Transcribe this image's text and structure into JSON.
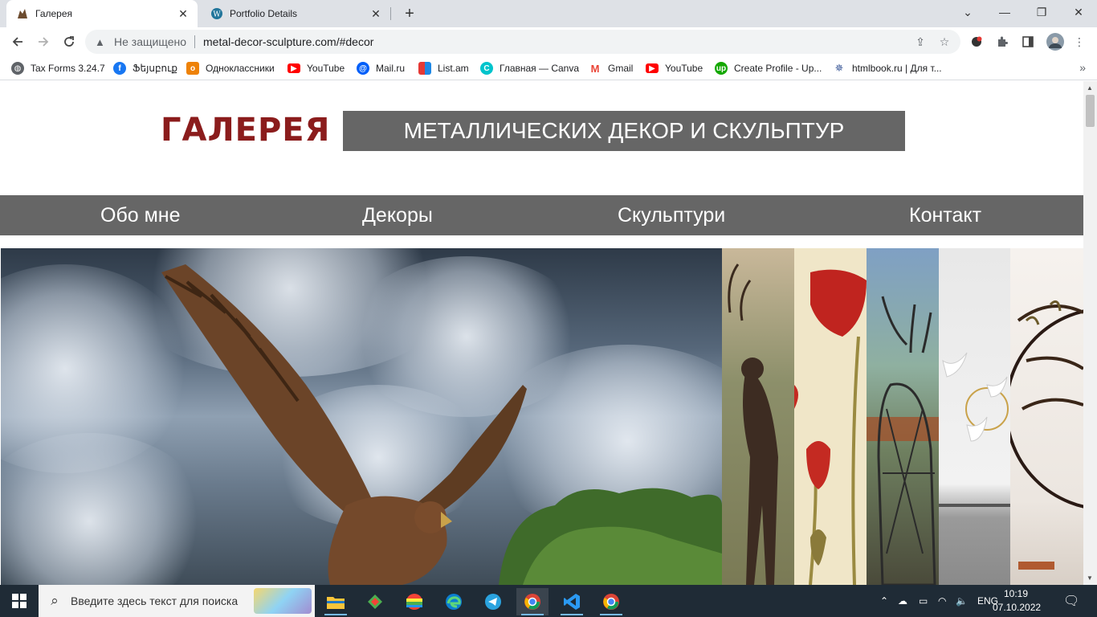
{
  "browser": {
    "tabs": [
      {
        "title": "Галерея",
        "icon": "sculpture-favicon",
        "active": true
      },
      {
        "title": "Portfolio Details",
        "icon": "wordpress-favicon",
        "active": false
      }
    ],
    "new_tab": "+",
    "window_controls": {
      "dropdown": "⌄",
      "minimize": "—",
      "restore": "❐",
      "close": "✕"
    },
    "omnibox": {
      "security_label": "Не защищено",
      "url": "metal-decor-sculpture.com/#decor"
    },
    "bookmarks": [
      {
        "label": "Tax Forms 3.24.7",
        "color": "#5f6368",
        "icon": "globe-icon"
      },
      {
        "label": "Ֆեյսբուք",
        "color": "#1877f2",
        "icon": "facebook-icon"
      },
      {
        "label": "Одноклассники",
        "color": "#ee8208",
        "icon": "ok-icon"
      },
      {
        "label": "YouTube",
        "color": "#ff0000",
        "icon": "youtube-icon"
      },
      {
        "label": "Mail.ru",
        "color": "#005ff9",
        "icon": "mailru-icon"
      },
      {
        "label": "List.am",
        "color": "#f4b400",
        "icon": "listam-icon"
      },
      {
        "label": "Главная — Canva",
        "color": "#00c4cc",
        "icon": "canva-icon"
      },
      {
        "label": "Gmail",
        "color": "#ea4335",
        "icon": "gmail-icon"
      },
      {
        "label": "YouTube",
        "color": "#ff0000",
        "icon": "youtube-icon"
      },
      {
        "label": "Create Profile - Up...",
        "color": "#14a800",
        "icon": "upwork-icon"
      },
      {
        "label": "htmlbook.ru | Для т...",
        "color": "#3b5998",
        "icon": "htmlbook-icon"
      }
    ],
    "bookmarks_more": "»"
  },
  "site": {
    "title": "ГАЛЕРЕЯ",
    "subtitle": "МЕТАЛЛИЧЕСКИХ ДЕКОР И СКУЛЬПТУР",
    "title_color": "#8b1c1c",
    "bar_color": "#666666",
    "menu": [
      "Обо мне",
      "Декоры",
      "Скульптури",
      "Контакт"
    ]
  },
  "taskbar": {
    "search_placeholder": "Введите здесь текст для поиска",
    "language": "ENG",
    "time": "10:19",
    "date": "07.10.2022"
  }
}
